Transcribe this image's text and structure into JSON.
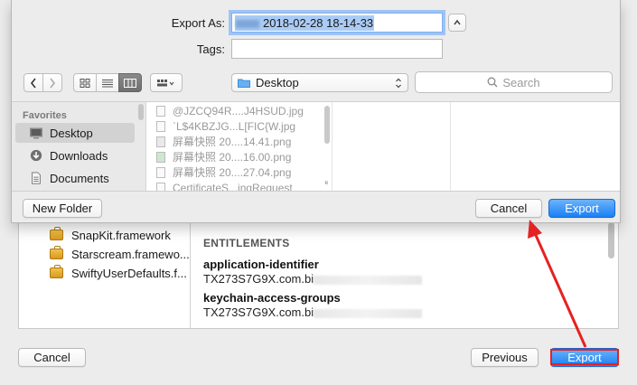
{
  "background": {
    "frameworks": [
      "SnapKit.framework",
      "Starscream.framewo...",
      "SwiftyUserDefaults.f..."
    ],
    "entitlements_heading": "ENTITLEMENTS",
    "entitlements": [
      {
        "key": "application-identifier",
        "value": "TX273S7G9X.com.bi"
      },
      {
        "key": "keychain-access-groups",
        "value": "TX273S7G9X.com.bi"
      }
    ],
    "cancel_label": "Cancel",
    "previous_label": "Previous",
    "export_label": "Export"
  },
  "sheet": {
    "export_as_label": "Export As:",
    "export_as_value": "2018-02-28 18-14-33",
    "tags_label": "Tags:",
    "tags_value": "",
    "location": "Desktop",
    "search_placeholder": "Search",
    "sidebar": {
      "heading": "Favorites",
      "items": [
        "Desktop",
        "Downloads",
        "Documents"
      ]
    },
    "files": [
      "@JZCQ94R....J4HSUD.jpg",
      "`L$4KBZJG...L[FIC{W.jpg",
      "屏幕快照 20....14.41.png",
      "屏幕快照 20....16.00.png",
      "屏幕快照 20....27.04.png",
      "CertificateS...ingRequest"
    ],
    "new_folder_label": "New Folder",
    "cancel_label": "Cancel",
    "export_label": "Export"
  },
  "colors": {
    "accent": "#1b80f5",
    "annotation": "#e52222"
  }
}
